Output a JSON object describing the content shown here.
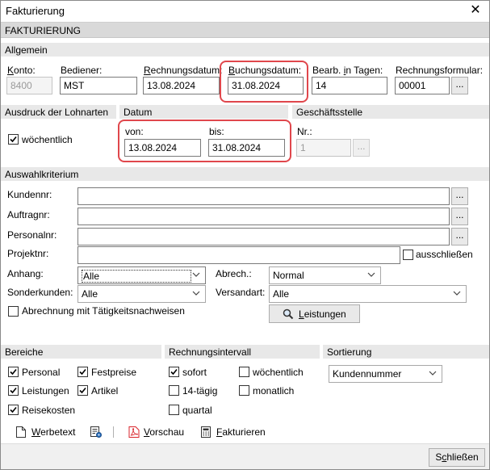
{
  "window": {
    "title": "Fakturierung",
    "close_glyph": "✕"
  },
  "banner": "FAKTURIERUNG",
  "allgemein": {
    "section": "Allgemein",
    "konto_label": "Konto:",
    "konto_value": "8400",
    "bediener_label": "Bediener:",
    "bediener_value": "MST",
    "rechnungsdatum_label": "Rechnungsdatum:",
    "rechnungsdatum_value": "13.08.2024",
    "buchungsdatum_label": "Buchungsdatum:",
    "buchungsdatum_value": "31.08.2024",
    "bearb_label": "Bearb. in Tagen:",
    "bearb_value": "14",
    "formular_label": "Rechnungsformular:",
    "formular_value": "00001",
    "dots": "..."
  },
  "ausdruck": {
    "section": "Ausdruck der Lohnarten",
    "woechentlich_label": "wöchentlich",
    "woechentlich_checked": true
  },
  "datum": {
    "section": "Datum",
    "von_label": "von:",
    "von_value": "13.08.2024",
    "bis_label": "bis:",
    "bis_value": "31.08.2024"
  },
  "geschaeftsstelle": {
    "section": "Geschäftsstelle",
    "nr_label": "Nr.:",
    "nr_value": "1",
    "dots": "..."
  },
  "auswahl": {
    "section": "Auswahlkriterium",
    "kundennr_label": "Kundennr:",
    "kundennr_value": "",
    "auftragnr_label": "Auftragnr:",
    "auftragnr_value": "",
    "personalnr_label": "Personalnr:",
    "personalnr_value": "",
    "projektnr_label": "Projektnr:",
    "projektnr_value": "",
    "ausschliessen_label": "ausschließen",
    "ausschliessen_checked": false,
    "anhang_label": "Anhang:",
    "anhang_value": "Alle",
    "abrech_label": "Abrech.:",
    "abrech_value": "Normal",
    "sonderkunden_label": "Sonderkunden:",
    "sonderkunden_value": "Alle",
    "versandart_label": "Versandart:",
    "versandart_value": "Alle",
    "taetigkeit_label": "Abrechnung mit Tätigkeitsnachweisen",
    "taetigkeit_checked": false,
    "leistungen_button": "Leistungen",
    "dots": "..."
  },
  "bereiche": {
    "section": "Bereiche",
    "personal_label": "Personal",
    "personal_checked": true,
    "festpreise_label": "Festpreise",
    "festpreise_checked": true,
    "leistungen_label": "Leistungen",
    "leistungen_checked": true,
    "artikel_label": "Artikel",
    "artikel_checked": true,
    "reisekosten_label": "Reisekosten",
    "reisekosten_checked": true
  },
  "intervall": {
    "section": "Rechnungsintervall",
    "sofort_label": "sofort",
    "sofort_checked": true,
    "woechentlich_label": "wöchentlich",
    "woechentlich_checked": false,
    "tag14_label": "14-tägig",
    "tag14_checked": false,
    "monatlich_label": "monatlich",
    "monatlich_checked": false,
    "quartal_label": "quartal",
    "quartal_checked": false
  },
  "sortierung": {
    "section": "Sortierung",
    "value": "Kundennummer"
  },
  "toolbar": {
    "werbetext": "Werbetext",
    "vorschau": "Vorschau",
    "fakturieren": "Fakturieren"
  },
  "footer": {
    "schliessen": "Schließen"
  },
  "colors": {
    "highlight": "#e0474c",
    "section_bg": "#e8e8e8",
    "pdf_red": "#d9262c"
  },
  "icons": [
    "close-icon",
    "chevron-down-icon",
    "checkmark-icon",
    "search-icon",
    "document-icon",
    "settings-form-icon",
    "pdf-icon",
    "calculator-icon"
  ]
}
